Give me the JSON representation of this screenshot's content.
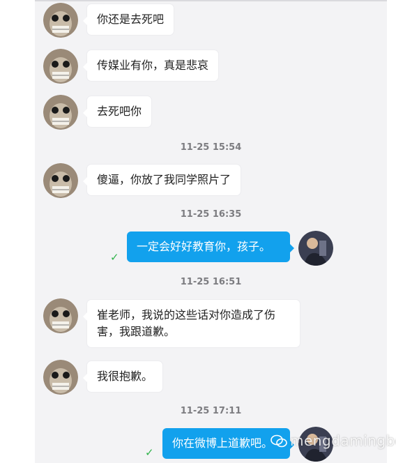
{
  "messages": [
    {
      "text": "你还是去死吧"
    },
    {
      "text": "传媒业有你，真是悲哀"
    },
    {
      "text": "去死吧你"
    },
    {
      "text": "傻逼，你放了我同学照片了"
    },
    {
      "text": "一定会好好教育你，孩子。"
    },
    {
      "text": "崔老师，我说的这些话对你造成了伤害，我跟道歉。"
    },
    {
      "text": "我很抱歉。"
    },
    {
      "text": "你在微博上道歉吧。"
    }
  ],
  "timestamps": [
    "11-25 15:54",
    "11-25 16:35",
    "11-25 16:51",
    "11-25 17:11"
  ],
  "icons": {
    "sent": "check-icon"
  },
  "colors": {
    "outgoing": "#12a1ed",
    "check": "#2fb34a"
  },
  "watermark": "mengdamingbo"
}
